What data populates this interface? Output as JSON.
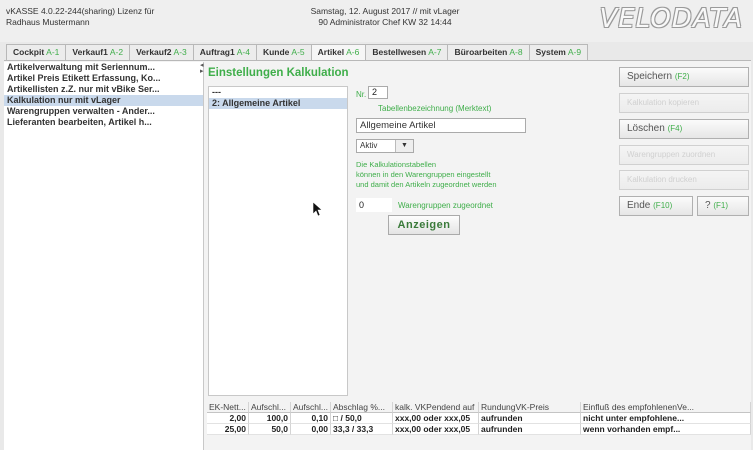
{
  "header": {
    "line1": "vKASSE 4.0.22-244(sharing) Lizenz für",
    "line2": "Radhaus Mustermann",
    "date": "Samstag, 12. August 2017 // mit vLager",
    "user": "90 Administrator Chef  KW 32  14:44",
    "logo": "VELODATA"
  },
  "tabs": [
    {
      "label": "Cockpit",
      "key": "A-1"
    },
    {
      "label": "Verkauf1",
      "key": "A-2"
    },
    {
      "label": "Verkauf2",
      "key": "A-3"
    },
    {
      "label": "Auftrag1",
      "key": "A-4"
    },
    {
      "label": "Kunde",
      "key": "A-5"
    },
    {
      "label": "Artikel",
      "key": "A-6"
    },
    {
      "label": "Bestellwesen",
      "key": "A-7"
    },
    {
      "label": "Büroarbeiten",
      "key": "A-8"
    },
    {
      "label": "System",
      "key": "A-9"
    }
  ],
  "sidebar": {
    "items": [
      "Artikelverwaltung mit Seriennum...",
      "Artikel Preis Etikett Erfassung, Ko...",
      "Artikellisten z.Z. nur mit vBike Ser...",
      "Kalkulation nur mit vLager",
      "Warengruppen verwalten - Ander...",
      "Lieferanten bearbeiten, Artikel h..."
    ]
  },
  "page": {
    "title": "Einstellungen Kalkulation",
    "list": [
      "---",
      "2: Allgemeine Artikel"
    ],
    "nr_label": "Nr.",
    "nr_value": "2",
    "tbez_label": "Tabellenbezeichnung (Merktext)",
    "tbez_value": "Allgemeine Artikel",
    "status": "Aktiv",
    "info_line1": "Die Kalkulationstabellen",
    "info_line2": "können in den Warengruppen eingestellt",
    "info_line3": "und damit den Artikeln zugeordnet werden",
    "wg_count": "0",
    "wg_label": "Warengruppen zugeordnet",
    "show_button": "Anzeigen"
  },
  "buttons": {
    "save": {
      "label": "Speichern",
      "key": "(F2)"
    },
    "disabled1": {
      "label": "",
      "key": "Kalkulation kopieren"
    },
    "delete": {
      "label": "Löschen",
      "key": "(F4)"
    },
    "disabled2": {
      "label": "",
      "key": "Warengruppen zuordnen"
    },
    "disabled3": {
      "label": "",
      "key": "Kalkulation drucken"
    },
    "end": {
      "label": "Ende",
      "key": "(F10)"
    },
    "help": {
      "label": "?",
      "key": "(F1)"
    }
  },
  "grid": {
    "headers": [
      "EK-Nett...",
      "Aufschl...",
      "Aufschl...",
      "Abschlag %...",
      "kalk. VKPendend auf",
      "RundungVK-Preis",
      "Einfluß des empfohlenenVe..."
    ],
    "rows": [
      [
        "2,00",
        "100,0",
        "0,10",
        "□ / 50,0",
        "xxx,00 oder xxx,05",
        "aufrunden",
        "nicht unter empfohlene..."
      ],
      [
        "25,00",
        "50,0",
        "0,00",
        "33,3 / 33,3",
        "xxx,00 oder xxx,05",
        "aufrunden",
        "wenn vorhanden empf..."
      ]
    ]
  }
}
